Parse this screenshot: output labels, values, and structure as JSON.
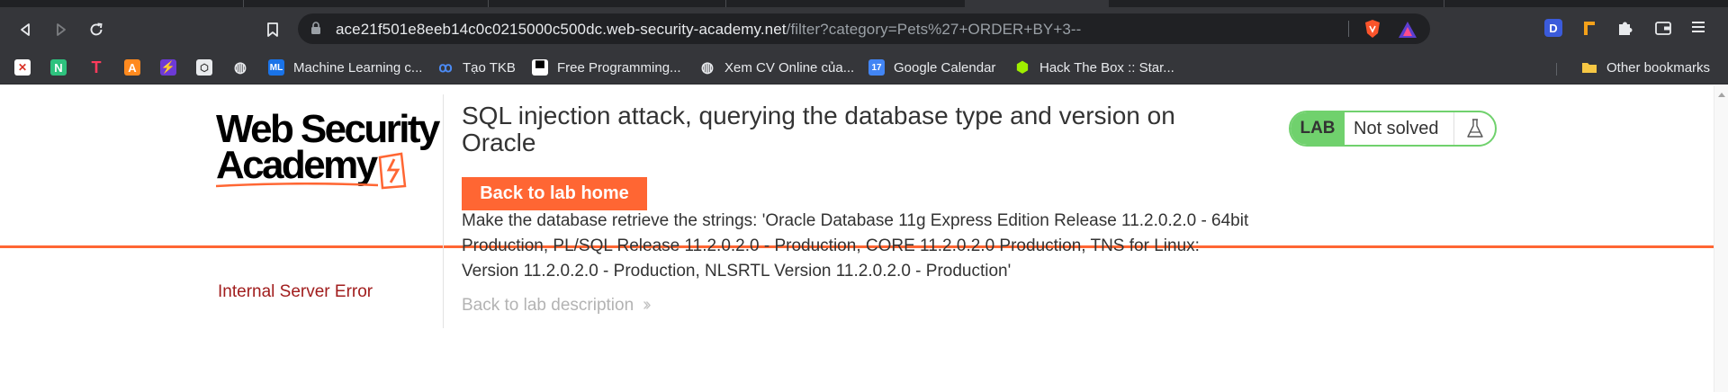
{
  "browser": {
    "url_host": "ace21f501e8eeb14c0c0215000c500dc.web-security-academy.net",
    "url_path": "/filter?category=Pets%27+ORDER+BY+3--",
    "bookmarks": [
      {
        "label": "",
        "icon": "gmail-x-icon"
      },
      {
        "label": "",
        "icon": "n-app-icon"
      },
      {
        "label": "",
        "icon": "t-app-icon"
      },
      {
        "label": "",
        "icon": "a-app-icon"
      },
      {
        "label": "",
        "icon": "lightning-icon"
      },
      {
        "label": "",
        "icon": "nodejs-icon"
      },
      {
        "label": "",
        "icon": "globe-icon"
      },
      {
        "label": "Machine Learning c...",
        "icon": "bookmark-favicon"
      },
      {
        "label": "Tạo TKB",
        "icon": "bookmark-favicon"
      },
      {
        "label": "Free Programming...",
        "icon": "bookmark-favicon"
      },
      {
        "label": "Xem CV Online của...",
        "icon": "globe-icon"
      },
      {
        "label": "Google Calendar",
        "icon": "calendar-icon"
      },
      {
        "label": "Hack The Box :: Star...",
        "icon": "htb-icon"
      }
    ],
    "other_bookmarks": "Other bookmarks"
  },
  "page": {
    "logo": {
      "line1": "Web Security",
      "line2": "Academy"
    },
    "title": "SQL injection attack, querying the database type and version on Oracle",
    "back_home": "Back to lab home",
    "description": "Make the database retrieve the strings: 'Oracle Database 11g Express Edition Release 11.2.0.2.0 - 64bit Production, PL/SQL Release 11.2.0.2.0 - Production, CORE 11.2.0.2.0 Production, TNS for Linux: Version 11.2.0.2.0 - Production, NLSRTL Version 11.2.0.2.0 - Production'",
    "back_description": "Back to lab description",
    "status": {
      "lab_badge": "LAB",
      "state": "Not solved"
    },
    "error": "Internal Server Error"
  },
  "colors": {
    "accent": "#ff6633",
    "lab_green": "#70d16d",
    "error_red": "#a11d1d",
    "chrome_dark": "#35363a"
  }
}
